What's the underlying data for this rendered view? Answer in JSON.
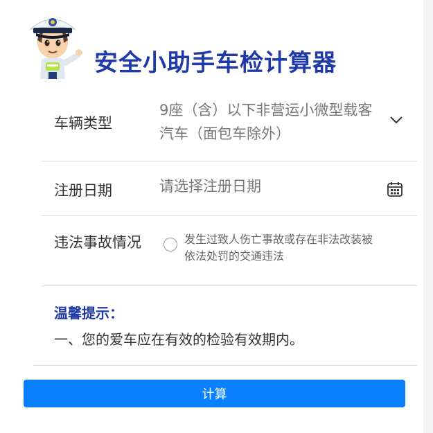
{
  "header": {
    "title": "安全小助手车检计算器",
    "mascot_icon": "traffic-police-mascot"
  },
  "form": {
    "vehicle_type": {
      "label": "车辆类型",
      "value": "9座（含）以下非营运小微型载客汽车（面包车除外）",
      "icon": "chevron-down-icon"
    },
    "register_date": {
      "label": "注册日期",
      "placeholder": "请选择注册日期",
      "icon": "calendar-icon"
    },
    "violation": {
      "label": "违法事故情况",
      "option_text": "发生过致人伤亡事故或存在非法改装被依法处罚的交通违法",
      "checked": false
    }
  },
  "tips": {
    "title": "温馨提示：",
    "items": [
      "一、您的爱车应在有效的检验有效期内。"
    ]
  },
  "actions": {
    "calculate_label": "计算"
  },
  "colors": {
    "title": "#1f3aa8",
    "button": "#0a80ff",
    "divider": "#dcdcdc"
  }
}
